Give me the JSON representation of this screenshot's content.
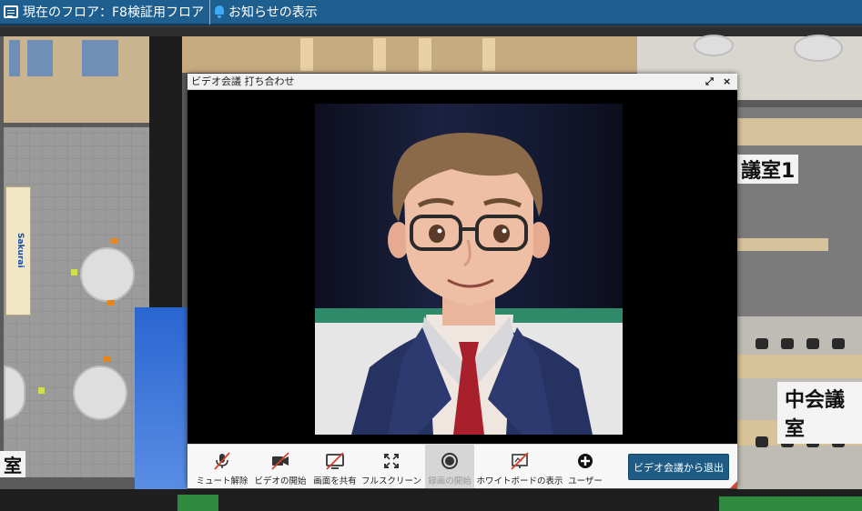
{
  "topbar": {
    "floor_label": "現在のフロア：F8検証用フロア",
    "notice_label": "お知らせの表示"
  },
  "scene": {
    "room_labels": [
      "議室1",
      "中会議室",
      "室"
    ],
    "sign_text": "Sakurai"
  },
  "dialog": {
    "title": "ビデオ会議 打ち合わせ",
    "expand_glyph": "⤢",
    "close_glyph": "×",
    "toolbar": [
      {
        "label": "ミュート解除",
        "icon": "mic-off-icon",
        "enabled": true
      },
      {
        "label": "ビデオの開始",
        "icon": "video-off-icon",
        "enabled": true
      },
      {
        "label": "画面を共有",
        "icon": "screen-share-off-icon",
        "enabled": true
      },
      {
        "label": "フルスクリーン",
        "icon": "fullscreen-icon",
        "enabled": true
      },
      {
        "label": "録画の開始",
        "icon": "record-icon",
        "enabled": false
      },
      {
        "label": "ホワイトボードの表示",
        "icon": "whiteboard-off-icon",
        "enabled": true
      },
      {
        "label": "ユーザー",
        "icon": "plus-circle-icon",
        "enabled": true
      }
    ],
    "leave_button": "ビデオ会議から退出"
  },
  "colors": {
    "topbar": "#1f5f8f",
    "leave_button": "#1e5c86",
    "accent_red": "#d9432b"
  }
}
